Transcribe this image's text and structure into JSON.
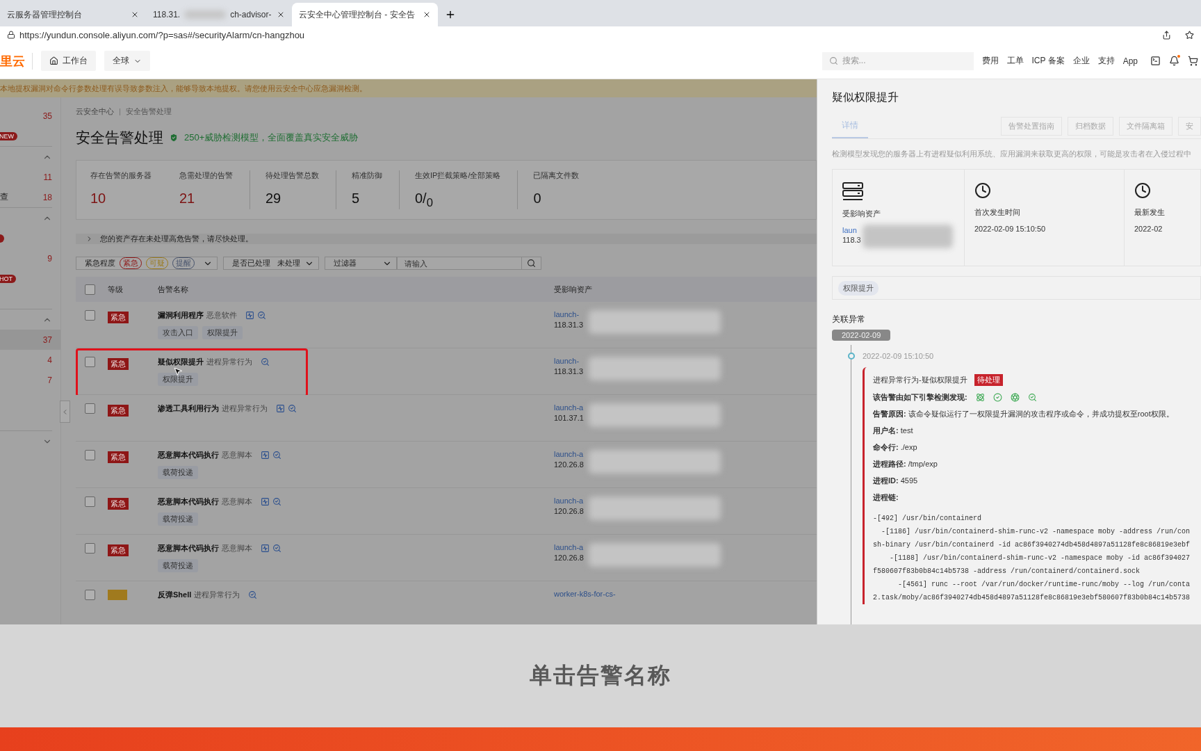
{
  "browser": {
    "tabs": [
      {
        "title": "云服务器管理控制台",
        "selected": false,
        "redacted": false
      },
      {
        "title": "118.31.",
        "title_after": "ch-advisor-",
        "selected": false,
        "redacted": true
      },
      {
        "title": "云安全中心管理控制台 - 安全告",
        "selected": true,
        "redacted": false
      }
    ],
    "url": "https://yundun.console.aliyun.com/?p=sas#/securityAlarm/cn-hangzhou"
  },
  "topnav": {
    "logo": "里云",
    "workbench": "工作台",
    "region": "全球",
    "search_placeholder": "搜索...",
    "links": [
      "费用",
      "工单",
      "ICP 备案",
      "企业",
      "支持",
      "App"
    ],
    "bell_dot": true
  },
  "banner": "本地提权漏洞对命令行参数处理有误导致参数注入，能够导致本地提权。请您使用云安全中心应急漏洞检测。",
  "sidebar": {
    "items": [
      {
        "kind": "count",
        "count": "35",
        "selected": false
      },
      {
        "kind": "badge",
        "badge": "NEW"
      },
      {
        "kind": "divider"
      },
      {
        "kind": "chevron",
        "expanded": true
      },
      {
        "kind": "count",
        "count": "11",
        "selected": false
      },
      {
        "kind": "count",
        "label": "查",
        "count": "18",
        "selected": false
      },
      {
        "kind": "divider"
      },
      {
        "kind": "chevron",
        "expanded": true
      },
      {
        "kind": "dot"
      },
      {
        "kind": "count",
        "count": "9",
        "selected": false
      },
      {
        "kind": "badge",
        "badge": "HOT"
      },
      {
        "kind": "gap"
      },
      {
        "kind": "divider"
      },
      {
        "kind": "chevron",
        "expanded": true
      },
      {
        "kind": "count",
        "count": "37",
        "selected": true
      },
      {
        "kind": "count",
        "count": "4",
        "selected": false
      },
      {
        "kind": "count",
        "count": "7",
        "selected": false
      },
      {
        "kind": "gap"
      },
      {
        "kind": "gap"
      },
      {
        "kind": "divider"
      },
      {
        "kind": "chevron",
        "expanded": false
      }
    ]
  },
  "breadcrumb": [
    "云安全中心",
    "安全告警处理"
  ],
  "page_title": "安全告警处理",
  "slogan": "250+威胁检测模型，全面覆盖真实安全威胁",
  "stat_groups": [
    {
      "items": [
        {
          "label": "存在告警的服务器",
          "value": "10",
          "alert": true
        },
        {
          "label": "急需处理的告警",
          "value": "21",
          "alert": true
        }
      ]
    },
    {
      "items": [
        {
          "label": "待处理告警总数",
          "value": "29",
          "alert": false
        }
      ]
    },
    {
      "items": [
        {
          "label": "精准防御",
          "value": "5",
          "alert": false
        }
      ]
    },
    {
      "items": [
        {
          "label": "生效IP拦截策略/全部策略",
          "value": "0/$_{0}$",
          "alert": false
        }
      ]
    },
    {
      "items": [
        {
          "label": "已隔离文件数",
          "value": "0",
          "alert": false
        }
      ]
    }
  ],
  "notice": "您的资产存在未处理高危告警，请尽快处理。",
  "filters": {
    "severity_label": "紧急程度",
    "severity_tags": [
      {
        "text": "紧急",
        "kind": "urgent"
      },
      {
        "text": "可疑",
        "kind": "suspicious"
      },
      {
        "text": "提醒",
        "kind": "reminder"
      }
    ],
    "handled_label": "是否已处理",
    "handled_value": "未处理",
    "filter_label": "过滤器",
    "input_placeholder": "请输入"
  },
  "table": {
    "all_checked": false,
    "columns": [
      "等级",
      "告警名称",
      "受影响资产"
    ],
    "rows": [
      {
        "kind": "urgent",
        "checked": false,
        "level": "紧急",
        "name": "漏洞利用程序",
        "category": "恶意软件",
        "icons": [
          {
            "kind": "chart"
          },
          {
            "kind": "search"
          }
        ],
        "tags": [
          "攻击入口",
          "权限提升"
        ],
        "asset": "launch-",
        "ip": "118.31.3",
        "highlighted": false
      },
      {
        "kind": "urgent",
        "checked": false,
        "level": "紧急",
        "name": "疑似权限提升",
        "category": "进程异常行为",
        "icons": [
          {
            "kind": "search"
          }
        ],
        "tags": [
          "权限提升"
        ],
        "asset": "launch-",
        "ip": "118.31.3",
        "highlighted": true
      },
      {
        "kind": "urgent",
        "checked": false,
        "level": "紧急",
        "name": "渗透工具利用行为",
        "category": "进程异常行为",
        "icons": [
          {
            "kind": "chart"
          },
          {
            "kind": "search"
          }
        ],
        "tags": [],
        "asset": "launch-a",
        "ip": "101.37.1",
        "highlighted": false
      },
      {
        "kind": "urgent",
        "checked": false,
        "level": "紧急",
        "name": "恶意脚本代码执行",
        "category": "恶意脚本",
        "icons": [
          {
            "kind": "chart"
          },
          {
            "kind": "search"
          }
        ],
        "tags": [
          "载荷投递"
        ],
        "asset": "launch-a",
        "ip": "120.26.8",
        "highlighted": false
      },
      {
        "kind": "urgent",
        "checked": false,
        "level": "紧急",
        "name": "恶意脚本代码执行",
        "category": "恶意脚本",
        "icons": [
          {
            "kind": "chart"
          },
          {
            "kind": "search"
          }
        ],
        "tags": [
          "载荷投递"
        ],
        "asset": "launch-a",
        "ip": "120.26.8",
        "highlighted": false
      },
      {
        "kind": "urgent",
        "checked": false,
        "level": "紧急",
        "name": "恶意脚本代码执行",
        "category": "恶意脚本",
        "icons": [
          {
            "kind": "chart"
          },
          {
            "kind": "search"
          }
        ],
        "tags": [
          "载荷投递"
        ],
        "asset": "launch-a",
        "ip": "120.26.8",
        "highlighted": false
      },
      {
        "kind": "suspicious",
        "checked": false,
        "name": "反弹Shell",
        "category": "进程异常行为",
        "icons": [
          {
            "kind": "search"
          }
        ],
        "tags": [],
        "asset": "worker-k8s-for-cs-",
        "highlighted": false
      }
    ]
  },
  "drawer": {
    "title": "疑似权限提升",
    "tabs": [
      {
        "label": "详情",
        "selected": true
      }
    ],
    "actions": [
      "告警处置指南",
      "归档数据",
      "文件隔离箱",
      "安"
    ],
    "description": "检测模型发现您的服务器上有进程疑似利用系统、应用漏洞来获取更高的权限，可能是攻击者在入侵过程中",
    "cards": [
      {
        "kind": "server",
        "label": "受影响资产",
        "link": "laun",
        "value": "118.3"
      },
      {
        "kind": "clock",
        "label": "首次发生时间",
        "value": "2022-02-09 15:10:50"
      },
      {
        "kind": "clock",
        "label": "最新发生",
        "value": "2022-02"
      }
    ],
    "tags": [
      "权限提升"
    ],
    "related_title": "关联异常",
    "date": "2022-02-09",
    "event": {
      "time": "2022-02-09 15:10:50",
      "title": "进程异常行为-疑似权限提升",
      "status": "待处理",
      "engines_label": "该告警由如下引擎检测发现:",
      "engines": [
        {
          "kind": "atom"
        },
        {
          "kind": "check"
        },
        {
          "kind": "aperture"
        },
        {
          "kind": "search"
        }
      ],
      "fields": [
        {
          "key": "告警原因:",
          "value": "该命令疑似运行了一权限提升漏洞的攻击程序或命令，并成功提权至root权限。"
        },
        {
          "key": "用户名:",
          "value": "test"
        },
        {
          "key": "命令行:",
          "value": "./exp"
        },
        {
          "key": "进程路径:",
          "value": "/tmp/exp"
        },
        {
          "key": "进程ID:",
          "value": "4595"
        },
        {
          "key": "进程链:"
        }
      ],
      "chain": [
        "-[492] /usr/bin/containerd",
        "  -[1186] /usr/bin/containerd-shim-runc-v2 -namespace moby -address /run/con",
        "sh-binary /usr/bin/containerd -id ac86f3940274db458d4897a51128fe8c86819e3ebf",
        "    -[1188] /usr/bin/containerd-shim-runc-v2 -namespace moby -id ac86f394027",
        "f580607f83b0b84c14b5738 -address /run/containerd/containerd.sock",
        "      -[4561] runc --root /var/run/docker/runtime-runc/moby --log /run/conta",
        "2.task/moby/ac86f3940274db458d4897a51128fe8c86819e3ebf580607f83b0b84c14b5738"
      ]
    }
  },
  "caption": "单击告警名称"
}
